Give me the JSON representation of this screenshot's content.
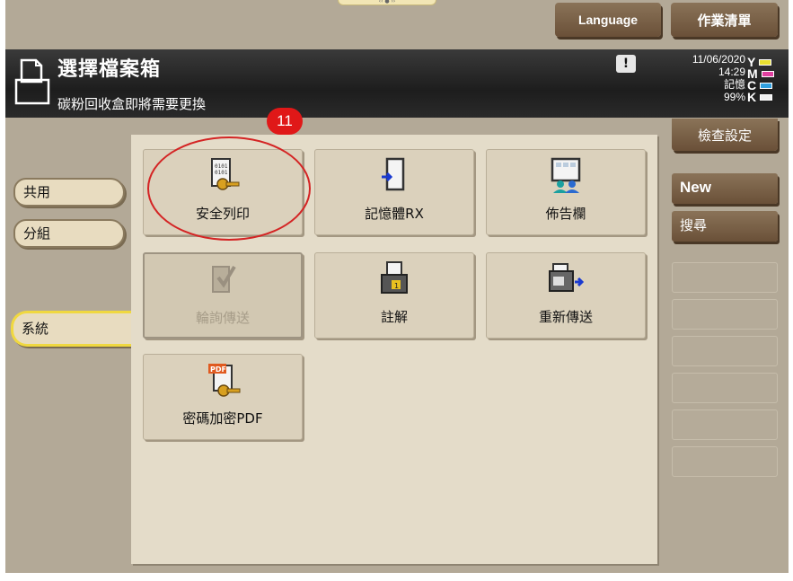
{
  "top": {
    "language_label": "Language",
    "job_list_label": "作業清單"
  },
  "header": {
    "title": "選擇檔案箱",
    "message": "碳粉回收盒即將需要更換",
    "alert_symbol": "!",
    "date": "11/06/2020",
    "time": "14:29",
    "memory_label": "記憶",
    "memory_value": "99%",
    "toner": [
      {
        "letter": "Y",
        "color": "#e8e030"
      },
      {
        "letter": "M",
        "color": "#e040a0"
      },
      {
        "letter": "C",
        "color": "#30a0e0"
      },
      {
        "letter": "K",
        "color": "#f0f0f0"
      }
    ]
  },
  "annotation": {
    "badge_number": "11"
  },
  "left_tabs": {
    "common": "共用",
    "group": "分組",
    "system": "系統"
  },
  "tiles": {
    "secure_print": "安全列印",
    "memory_rx": "記憶體RX",
    "bulletin": "佈告欄",
    "polling_tx": "輪詢傳送",
    "annotation": "註解",
    "resend": "重新傳送",
    "encrypted_pdf": "密碼加密PDF"
  },
  "right_panel": {
    "check_settings": "檢查設定",
    "new": "New",
    "search": "搜尋"
  }
}
